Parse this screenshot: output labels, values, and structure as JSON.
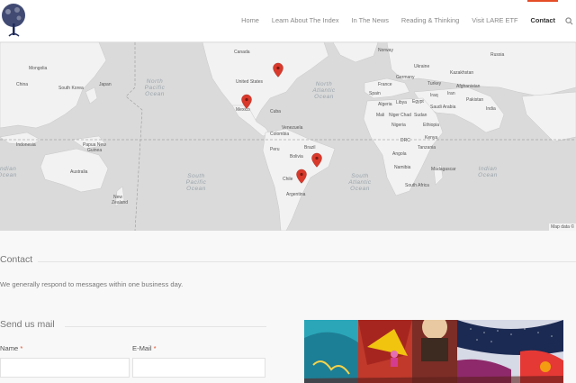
{
  "nav": {
    "items": [
      "Home",
      "Learn About The Index",
      "In The News",
      "Reading & Thinking",
      "Visit LARE ETF",
      "Contact"
    ],
    "active": "Contact",
    "accent": "#e44d26"
  },
  "map": {
    "attribution": "Map data ©",
    "labels": {
      "north_pacific": "North\nPacific\nOcean",
      "north_atlantic": "North\nAtlantic\nOcean",
      "south_pacific": "South\nPacific\nOcean",
      "south_atlantic": "South\nAtlantic\nOcean",
      "indian": "Indian\nOcean",
      "indian_left": "Indian\nOcean"
    },
    "countries": [
      "Mongolia",
      "China",
      "South Korea",
      "Japan",
      "India",
      "Indonesia",
      "Papua New Guinea",
      "Australia",
      "New Zealand",
      "Canada",
      "United States",
      "Mexico",
      "Cuba",
      "Venezuela",
      "Colombia",
      "Peru",
      "Brazil",
      "Bolivia",
      "Chile",
      "Argentina",
      "Russia",
      "Kazakhstan",
      "Ukraine",
      "Spain",
      "France",
      "Germany",
      "Turkey",
      "Iraq",
      "Iran",
      "Afghanistan",
      "Saudi Arabia",
      "Egypt",
      "Libya",
      "Algeria",
      "Mali",
      "Niger",
      "Nigeria",
      "Chad",
      "Sudan",
      "Ethiopia",
      "Kenya",
      "Tanzania",
      "DRC",
      "Angola",
      "Namibia",
      "South Africa",
      "Madagascar",
      "Pakistan",
      "Norway"
    ],
    "marker_color": "#d9392b"
  },
  "contact": {
    "title": "Contact",
    "description": "We generally respond to messages within one business day."
  },
  "form": {
    "title": "Send us mail",
    "name_label": "Name",
    "email_label": "E-Mail",
    "required_mark": "*"
  }
}
